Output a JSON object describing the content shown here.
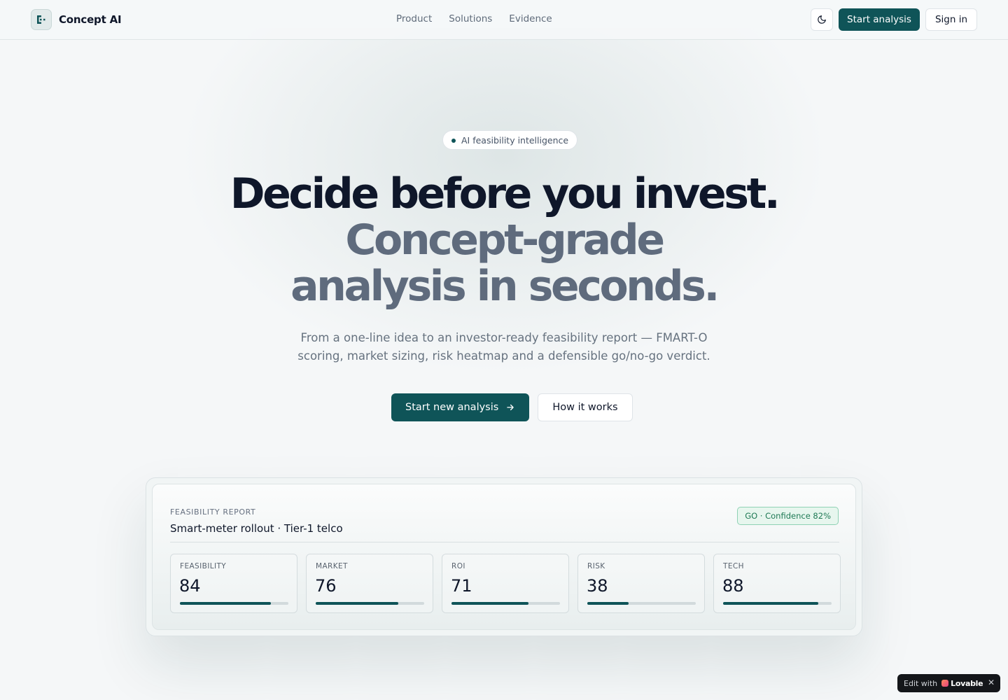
{
  "header": {
    "brand": "Concept AI",
    "nav": [
      "Product",
      "Solutions",
      "Evidence"
    ],
    "start_label": "Start analysis",
    "signin_label": "Sign in"
  },
  "hero": {
    "pill": "AI feasibility intelligence",
    "title_line1": "Decide before you invest.",
    "title_line2": "Concept-grade analysis in seconds.",
    "subtitle": "From a one-line idea to an investor-ready feasibility report — FMART-O scoring, market sizing, risk heatmap and a defensible go/no-go verdict.",
    "cta_primary": "Start new analysis",
    "cta_secondary": "How it works"
  },
  "report": {
    "label": "FEASIBILITY REPORT",
    "title": "Smart-meter rollout · Tier-1 telco",
    "verdict": "GO · Confidence 82%",
    "metrics": [
      {
        "label": "FEASIBILITY",
        "value": "84",
        "level": 0.84
      },
      {
        "label": "MARKET",
        "value": "76",
        "level": 0.76
      },
      {
        "label": "ROI",
        "value": "71",
        "level": 0.71
      },
      {
        "label": "RISK",
        "value": "38",
        "level": 0.38
      },
      {
        "label": "TECH",
        "value": "88",
        "level": 0.88
      }
    ]
  },
  "badge": {
    "edit": "Edit with",
    "name": "Lovable",
    "close": "✕"
  },
  "colors": {
    "accent": "#0f5458",
    "background": "#f5f7f8",
    "verdict_green": "#1f7a55"
  },
  "icons": [
    "concept-ai-logo-icon",
    "moon-icon",
    "arrow-right-icon",
    "lovable-heart-icon",
    "close-icon"
  ]
}
